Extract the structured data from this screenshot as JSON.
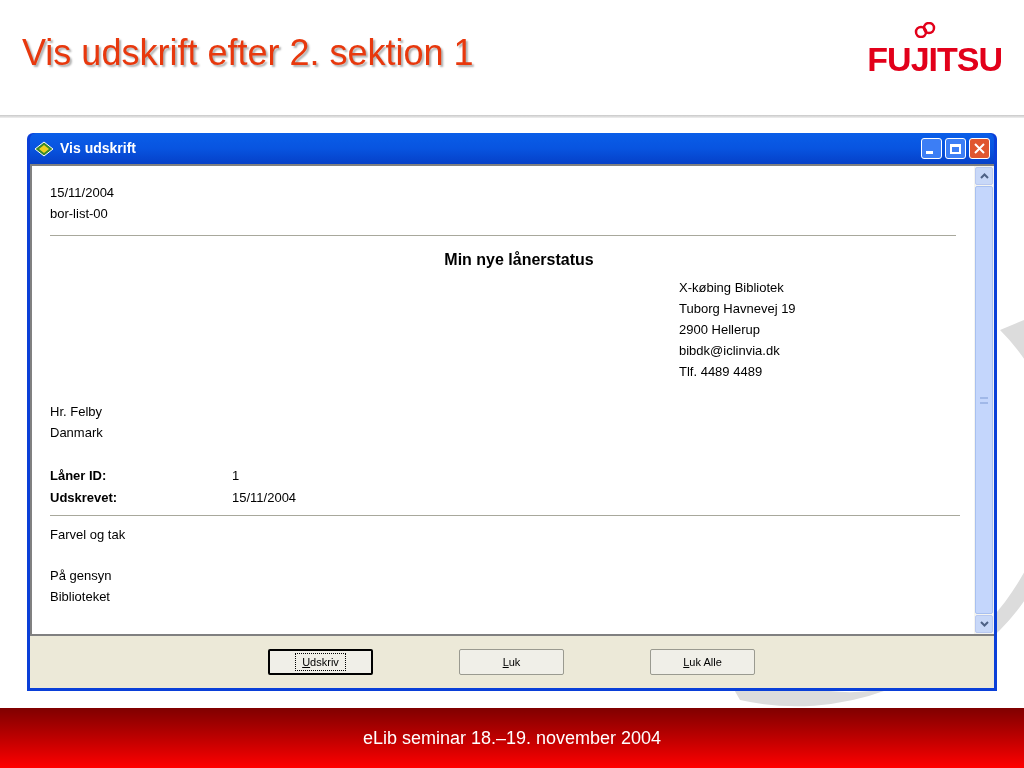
{
  "slide": {
    "title": "Vis udskrift efter 2. sektion 1",
    "logo": "FUJITSU",
    "footer": "eLib seminar 18.–19. november 2004"
  },
  "window": {
    "title": "Vis udskrift",
    "controls": [
      {
        "kind": "minimize"
      },
      {
        "kind": "maximize"
      },
      {
        "kind": "close"
      }
    ]
  },
  "document": {
    "date": "15/11/2004",
    "report_id": "bor-list-00",
    "heading": "Min nye lånerstatus",
    "library_address": [
      "X-købing Bibliotek",
      "Tuborg Havnevej 19",
      "2900 Hellerup",
      "bibdk@iclinvia.dk",
      "Tlf. 4489 4489"
    ],
    "recipient": [
      "Hr. Felby",
      "Danmark"
    ],
    "fields": [
      {
        "label": "Låner ID:",
        "value": "1"
      },
      {
        "label": "Udskrevet:",
        "value": "15/11/2004"
      }
    ],
    "closing": [
      "Farvel og tak"
    ],
    "signature": [
      "På gensyn",
      "Biblioteket"
    ]
  },
  "buttons": [
    {
      "label": "Udskriv",
      "focused": true
    },
    {
      "label": "Luk",
      "focused": false
    },
    {
      "label": "Luk Alle",
      "focused": false
    }
  ]
}
